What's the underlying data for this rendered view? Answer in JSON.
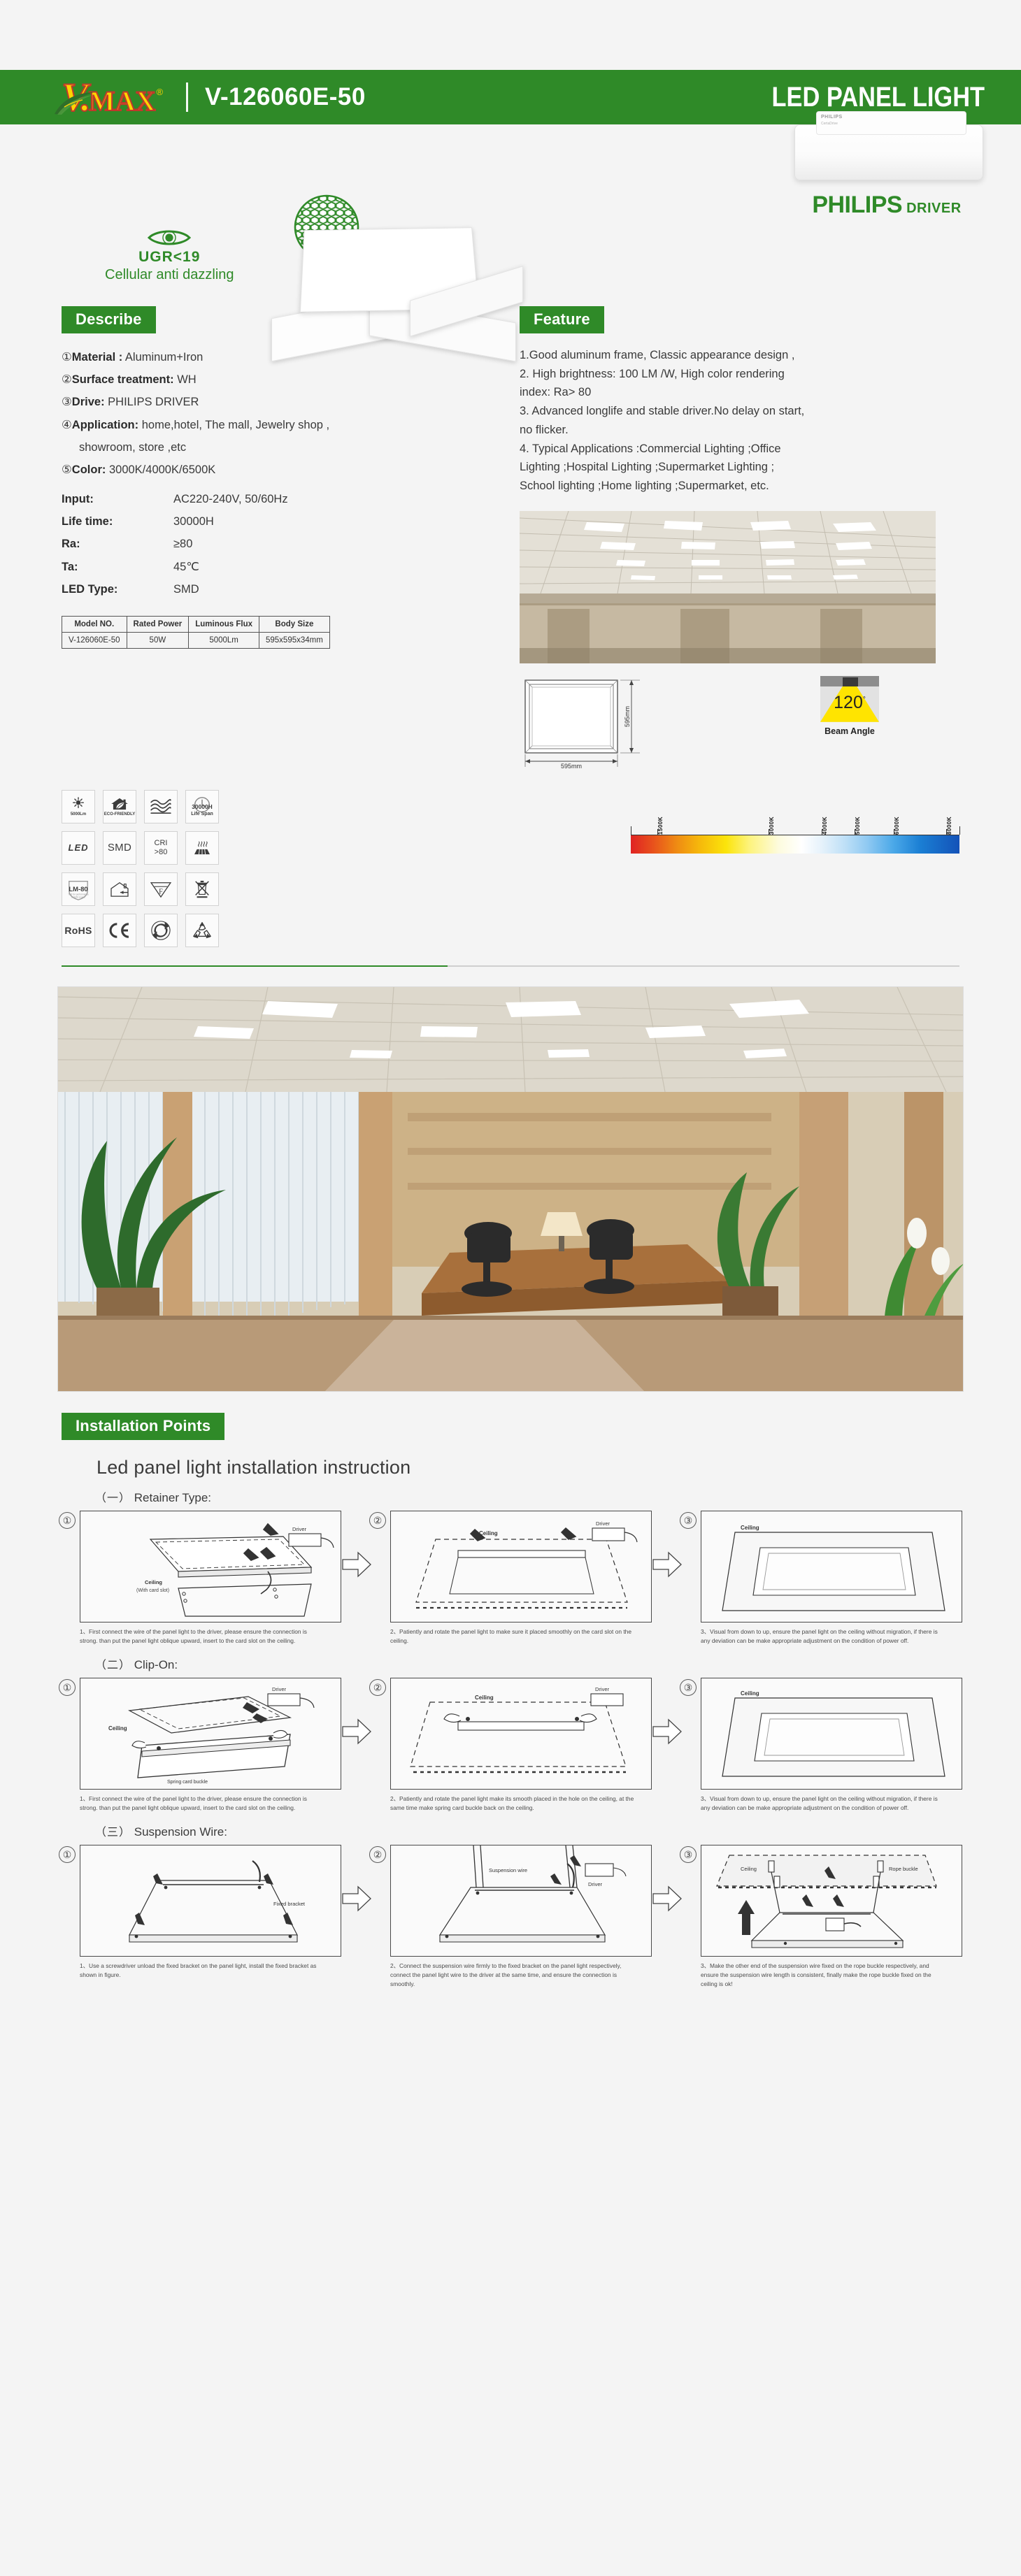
{
  "header": {
    "logo_v": "V.",
    "logo_max": "MAX",
    "registered": "®",
    "model_code": "V-126060E-50",
    "product_title": "LED PANEL LIGHT",
    "brand_green": "#2f8a28"
  },
  "hero": {
    "ugr_value": "UGR<19",
    "ugr_caption": "Cellular anti dazzling",
    "driver_brand": "PHILIPS",
    "driver_word": "DRIVER",
    "driver_chip_brand": "PHILIPS",
    "driver_chip_sub": "CertaDrive"
  },
  "describe": {
    "tag": "Describe",
    "items": [
      {
        "num": "①",
        "label": "Material :",
        "value": "Aluminum+Iron"
      },
      {
        "num": "②",
        "label": "Surface treatment:",
        "value": "WH"
      },
      {
        "num": "③",
        "label": "Drive:",
        "value": "PHILIPS DRIVER"
      },
      {
        "num": "④",
        "label": "Application:",
        "value": "home,hotel, The mall,  Jewelry shop ,",
        "value_line2": "showroom, store ,etc"
      },
      {
        "num": "⑤",
        "label": "Color:",
        "value": "3000K/4000K/6500K"
      }
    ],
    "kv": [
      {
        "k": "Input:",
        "v": "AC220-240V, 50/60Hz"
      },
      {
        "k": "Life time:",
        "v": "30000H"
      },
      {
        "k": "Ra:",
        "v": "≥80"
      },
      {
        "k": "Ta:",
        "v": "45℃"
      },
      {
        "k": "LED Type:",
        "v": "SMD"
      }
    ]
  },
  "spec_table": {
    "headers": [
      "Model NO.",
      "Rated Power",
      "Luminous Flux",
      "Body Size"
    ],
    "rows": [
      [
        "V-126060E-50",
        "50W",
        "5000Lm",
        "595x595x34mm"
      ]
    ]
  },
  "feature": {
    "tag": "Feature",
    "lines": [
      "1.Good aluminum frame, Classic appearance design ,",
      "2. High brightness: 100 LM /W, High color rendering",
      "index:  Ra> 80",
      "3. Advanced longlife and stable driver.No delay on start,",
      "no flicker.",
      "4. Typical Applications :Commercial Lighting ;Office",
      "Lighting ;Hospital Lighting ;Supermarket Lighting ;",
      "School lighting ;Home lighting  ;Supermarket, etc."
    ]
  },
  "dimension": {
    "width_label": "595mm",
    "height_label": "595mm"
  },
  "beam": {
    "value": "120",
    "degree": "°",
    "caption": "Beam Angle"
  },
  "icon_grid": [
    {
      "name": "brightness-icon",
      "t1": "",
      "t2": "5000Lm"
    },
    {
      "name": "eco-house-icon",
      "t1": "",
      "t2": "ECO-FRIENDLY"
    },
    {
      "name": "no-flicker-icon",
      "t1": "",
      "t2": ""
    },
    {
      "name": "life-span-icon",
      "t1": "30000",
      "t2": "Life Span"
    },
    {
      "name": "led-icon",
      "t1": "LED",
      "t2": ""
    },
    {
      "name": "smd-icon",
      "t1": "SMD",
      "t2": ""
    },
    {
      "name": "cri-icon",
      "t1": "CRI",
      "t2": ">80"
    },
    {
      "name": "heat-dissipation-icon",
      "t1": "",
      "t2": ""
    },
    {
      "name": "lm80-icon",
      "t1": "LM-80",
      "t2": ""
    },
    {
      "name": "indoor-use-icon",
      "t1": "",
      "t2": ""
    },
    {
      "name": "f-mark-icon",
      "t1": "F",
      "t2": ""
    },
    {
      "name": "weee-bin-icon",
      "t1": "",
      "t2": ""
    },
    {
      "name": "rohs-icon",
      "t1": "RoHS",
      "t2": ""
    },
    {
      "name": "ce-icon",
      "t1": "CE",
      "t2": ""
    },
    {
      "name": "green-dot-icon",
      "t1": "",
      "t2": ""
    },
    {
      "name": "recycle-icon",
      "t1": "",
      "t2": ""
    }
  ],
  "cct_scale": {
    "ticks": [
      "1500K",
      "3000K",
      "4000K",
      "5000K",
      "6000K",
      "8000K"
    ],
    "positions": [
      8,
      42,
      58,
      68,
      80,
      96
    ]
  },
  "installation": {
    "tag": "Installation Points",
    "title": "Led panel light installation instruction",
    "types": [
      {
        "cn_num": "（一）",
        "name": "Retainer Type:",
        "labels": {
          "ceiling": "Ceiling",
          "ceiling_sub": "(With card slot)",
          "driver": "Driver"
        },
        "steps": [
          {
            "num": "①",
            "caption": "1、First connect the wire of the panel light to the driver, please ensure the connection is strong. than put the panel light oblique upward, insert to the card slot on the ceiling."
          },
          {
            "num": "②",
            "caption": "2、Patiently and rotate the panel light to make sure it placed smoothly on the card slot on the ceiling."
          },
          {
            "num": "③",
            "caption": "3、Visual from down to up, ensure the panel light on the ceiling without migration, if there is any deviation can be make appropriate adjustment on the condition of power off."
          }
        ]
      },
      {
        "cn_num": "（二）",
        "name": "Clip-On:",
        "labels": {
          "ceiling": "Ceiling",
          "ceiling_sub": "Spring card buckle",
          "driver": "Driver"
        },
        "steps": [
          {
            "num": "①",
            "caption": "1、First connect the wire of the panel light to the driver, please ensure the connection is strong. than put the panel light oblique upward, insert to the card slot on the ceiling."
          },
          {
            "num": "②",
            "caption": "2、Patiently and rotate the panel light make its smooth placed in the hole on the ceiling, at the same time make spring card buckle back on the ceiling."
          },
          {
            "num": "③",
            "caption": "3、Visual from down to up, ensure the panel light on the ceiling without migration, if there is any deviation can be make appropriate adjustment on the condition of power off."
          }
        ]
      },
      {
        "cn_num": "（三）",
        "name": "Suspension Wire:",
        "labels": {
          "ceiling": "Ceiling",
          "bracket": "Fixed bracket",
          "wire": "Suspension wire",
          "driver": "Driver",
          "buckle": "Rope buckle"
        },
        "steps": [
          {
            "num": "①",
            "caption": "1、Use a screwdriver unload the fixed bracket on the panel light, install the fixed bracket as shown in figure."
          },
          {
            "num": "②",
            "caption": "2、Connect the suspension wire firmly to the fixed bracket on the panel light respectively, connect the panel light wire to the driver at the same time, and ensure the connection is smoothly."
          },
          {
            "num": "③",
            "caption": "3、Make the other end of the suspension wire fixed on the rope buckle respectively, and ensure the suspension wire length is consistent, finally make the rope buckle fixed on the ceiling is ok!"
          }
        ]
      }
    ]
  }
}
